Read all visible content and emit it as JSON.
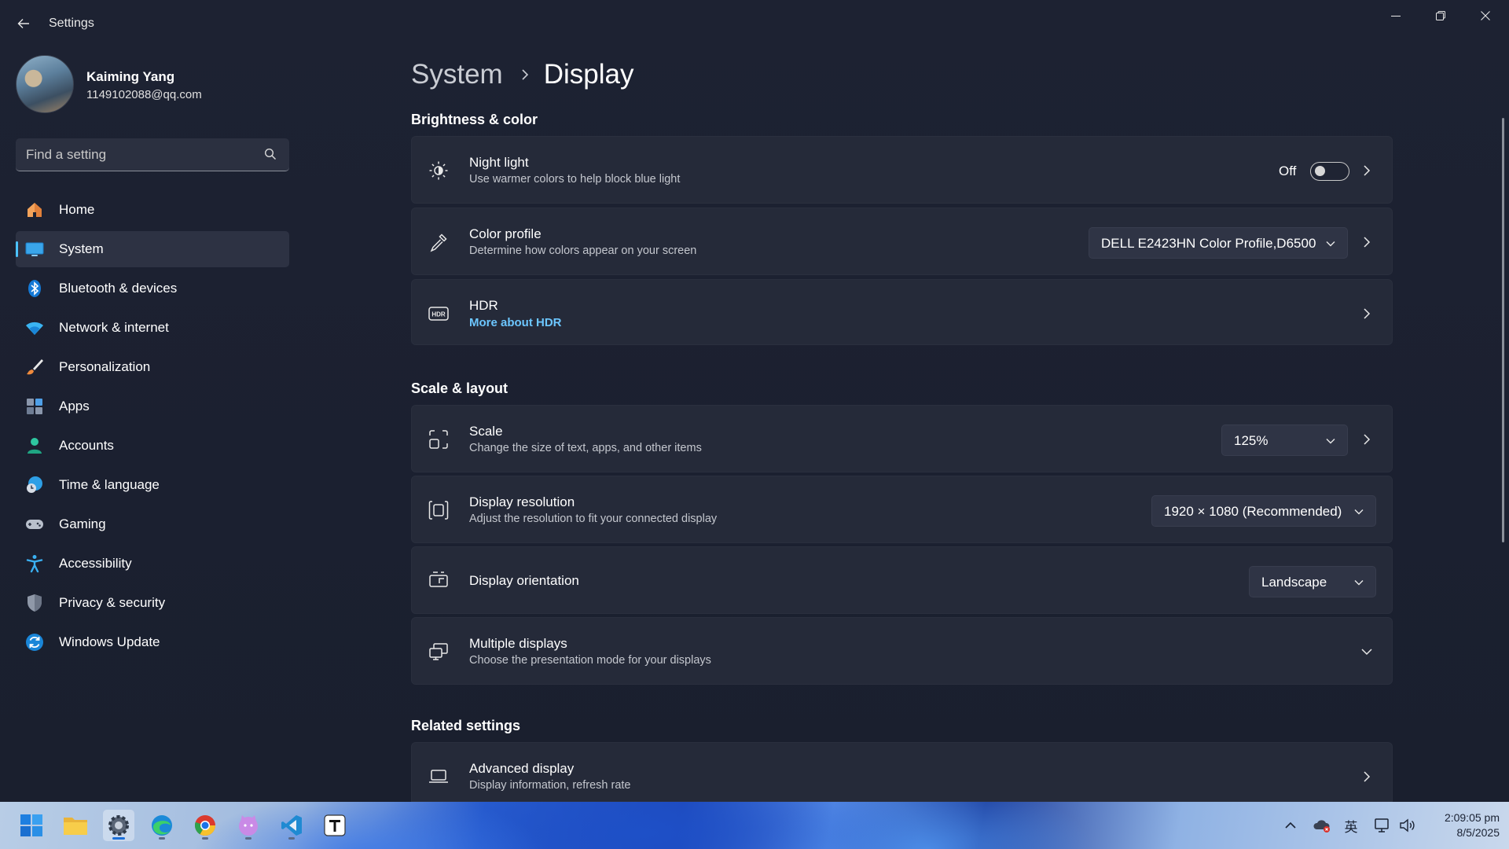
{
  "window": {
    "title": "Settings"
  },
  "user": {
    "name": "Kaiming Yang",
    "email": "1149102088@qq.com"
  },
  "search": {
    "placeholder": "Find a setting"
  },
  "sidebar": {
    "items": [
      {
        "label": "Home",
        "icon": "home-icon"
      },
      {
        "label": "System",
        "icon": "system-icon",
        "active": true
      },
      {
        "label": "Bluetooth & devices",
        "icon": "bluetooth-icon"
      },
      {
        "label": "Network & internet",
        "icon": "wifi-icon"
      },
      {
        "label": "Personalization",
        "icon": "brush-icon"
      },
      {
        "label": "Apps",
        "icon": "apps-icon"
      },
      {
        "label": "Accounts",
        "icon": "accounts-icon"
      },
      {
        "label": "Time & language",
        "icon": "clock-globe-icon"
      },
      {
        "label": "Gaming",
        "icon": "gamepad-icon"
      },
      {
        "label": "Accessibility",
        "icon": "accessibility-icon"
      },
      {
        "label": "Privacy & security",
        "icon": "shield-icon"
      },
      {
        "label": "Windows Update",
        "icon": "update-icon"
      }
    ]
  },
  "breadcrumb": {
    "parent": "System",
    "current": "Display"
  },
  "sections": {
    "brightness": "Brightness & color",
    "scale": "Scale & layout",
    "related": "Related settings"
  },
  "cards": {
    "night_light": {
      "title": "Night light",
      "sub": "Use warmer colors to help block blue light",
      "toggle_label": "Off",
      "toggle_on": false
    },
    "color_profile": {
      "title": "Color profile",
      "sub": "Determine how colors appear on your screen",
      "value": "DELL E2423HN Color Profile,D6500"
    },
    "hdr": {
      "title": "HDR",
      "link": "More about HDR"
    },
    "scale": {
      "title": "Scale",
      "sub": "Change the size of text, apps, and other items",
      "value": "125%"
    },
    "resolution": {
      "title": "Display resolution",
      "sub": "Adjust the resolution to fit your connected display",
      "value": "1920 × 1080 (Recommended)"
    },
    "orientation": {
      "title": "Display orientation",
      "value": "Landscape"
    },
    "multiple": {
      "title": "Multiple displays",
      "sub": "Choose the presentation mode for your displays"
    },
    "advanced": {
      "title": "Advanced display",
      "sub": "Display information, refresh rate"
    }
  },
  "taskbar": {
    "apps": [
      "start-icon",
      "file-explorer-icon",
      "settings-icon",
      "edge-icon",
      "chrome-icon",
      "cat-app-icon",
      "vscode-icon",
      "typora-icon"
    ],
    "tray": {
      "ime": "英"
    },
    "clock": {
      "time": "2:09:05 pm",
      "date": "8/5/2025"
    }
  },
  "colors": {
    "accent": "#4cc2ff",
    "link": "#6cc6ff",
    "background": "#1c2131",
    "card": "#252a39"
  }
}
